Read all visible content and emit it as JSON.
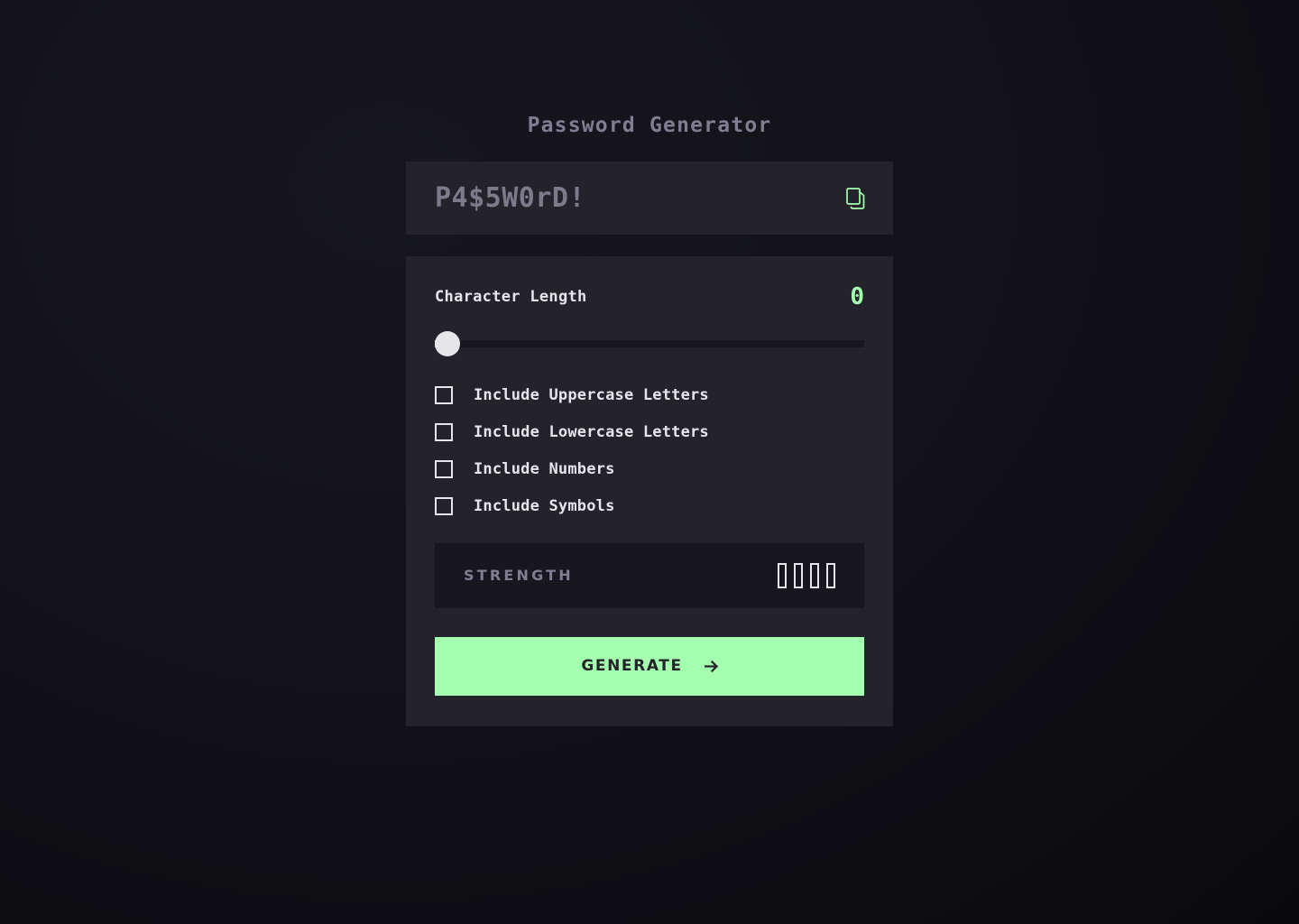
{
  "app": {
    "title": "Password Generator"
  },
  "password_display": {
    "value": "P4$5W0rD!",
    "copy_icon_name": "copy-icon"
  },
  "options": {
    "length": {
      "label": "Character Length",
      "value": "0",
      "slider_percent": 0
    },
    "checkboxes": [
      {
        "label": "Include Uppercase Letters",
        "checked": false
      },
      {
        "label": "Include Lowercase Letters",
        "checked": false
      },
      {
        "label": "Include Numbers",
        "checked": false
      },
      {
        "label": "Include Symbols",
        "checked": false
      }
    ],
    "strength": {
      "label": "STRENGTH",
      "rating": "",
      "bars_filled": 0,
      "bars_total": 4
    },
    "generate": {
      "label": "GENERATE",
      "arrow": "→"
    }
  },
  "colors": {
    "accent_green": "#A4FFAF",
    "panel": "#24232B",
    "panel_dark": "#18171F",
    "background": "#14131B",
    "text_muted": "#817D92",
    "text": "#E6E5EA"
  }
}
